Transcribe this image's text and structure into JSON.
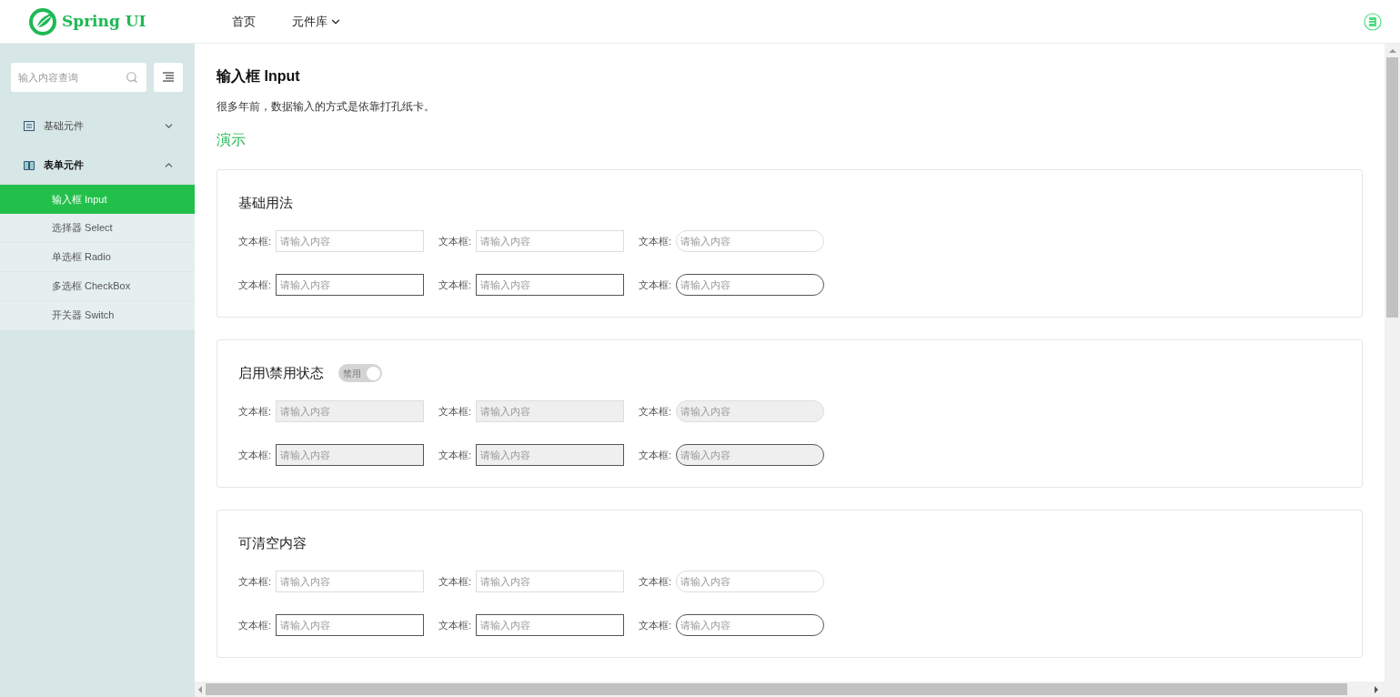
{
  "header": {
    "logo_text": "Spring UI",
    "nav": [
      {
        "label": "首页",
        "dropdown": false
      },
      {
        "label": "元件库",
        "dropdown": true
      }
    ]
  },
  "sidebar": {
    "search": {
      "placeholder": "输入内容查询"
    },
    "groups": [
      {
        "label": "基础元件",
        "expanded": false
      },
      {
        "label": "表单元件",
        "expanded": true,
        "children": [
          {
            "label": "输入框 Input",
            "selected": true
          },
          {
            "label": "选择器 Select",
            "selected": false
          },
          {
            "label": "单选框 Radio",
            "selected": false
          },
          {
            "label": "多选框 CheckBox",
            "selected": false
          },
          {
            "label": "开关器 Switch",
            "selected": false
          }
        ]
      }
    ]
  },
  "page": {
    "title": "输入框 Input",
    "description": "很多年前，数据输入的方式是依靠打孔纸卡。",
    "demo_heading": "演示"
  },
  "sections": [
    {
      "title": "基础用法",
      "rows": [
        [
          {
            "label": "文本框:",
            "placeholder": "请输入内容",
            "rounded": false,
            "dark_border": false,
            "disabled": false
          },
          {
            "label": "文本框:",
            "placeholder": "请输入内容",
            "rounded": false,
            "dark_border": false,
            "disabled": false
          },
          {
            "label": "文本框:",
            "placeholder": "请输入内容",
            "rounded": true,
            "dark_border": false,
            "disabled": false
          }
        ],
        [
          {
            "label": "文本框:",
            "placeholder": "请输入内容",
            "rounded": false,
            "dark_border": true,
            "disabled": false
          },
          {
            "label": "文本框:",
            "placeholder": "请输入内容",
            "rounded": false,
            "dark_border": true,
            "disabled": false
          },
          {
            "label": "文本框:",
            "placeholder": "请输入内容",
            "rounded": true,
            "dark_border": true,
            "disabled": false
          }
        ]
      ]
    },
    {
      "title": "启用\\禁用状态",
      "switch": {
        "label": "禁用",
        "on": true
      },
      "rows": [
        [
          {
            "label": "文本框:",
            "placeholder": "请输入内容",
            "rounded": false,
            "dark_border": false,
            "disabled": true
          },
          {
            "label": "文本框:",
            "placeholder": "请输入内容",
            "rounded": false,
            "dark_border": false,
            "disabled": true
          },
          {
            "label": "文本框:",
            "placeholder": "请输入内容",
            "rounded": true,
            "dark_border": false,
            "disabled": true
          }
        ],
        [
          {
            "label": "文本框:",
            "placeholder": "请输入内容",
            "rounded": false,
            "dark_border": true,
            "disabled": true
          },
          {
            "label": "文本框:",
            "placeholder": "请输入内容",
            "rounded": false,
            "dark_border": true,
            "disabled": true
          },
          {
            "label": "文本框:",
            "placeholder": "请输入内容",
            "rounded": true,
            "dark_border": true,
            "disabled": true
          }
        ]
      ]
    },
    {
      "title": "可清空内容",
      "rows": [
        [
          {
            "label": "文本框:",
            "placeholder": "请输入内容",
            "rounded": false,
            "dark_border": false,
            "disabled": false
          },
          {
            "label": "文本框:",
            "placeholder": "请输入内容",
            "rounded": false,
            "dark_border": false,
            "disabled": false
          },
          {
            "label": "文本框:",
            "placeholder": "请输入内容",
            "rounded": true,
            "dark_border": false,
            "disabled": false
          }
        ],
        [
          {
            "label": "文本框:",
            "placeholder": "请输入内容",
            "rounded": false,
            "dark_border": true,
            "disabled": false
          },
          {
            "label": "文本框:",
            "placeholder": "请输入内容",
            "rounded": false,
            "dark_border": true,
            "disabled": false
          },
          {
            "label": "文本框:",
            "placeholder": "请输入内容",
            "rounded": true,
            "dark_border": true,
            "disabled": false
          }
        ]
      ]
    }
  ]
}
